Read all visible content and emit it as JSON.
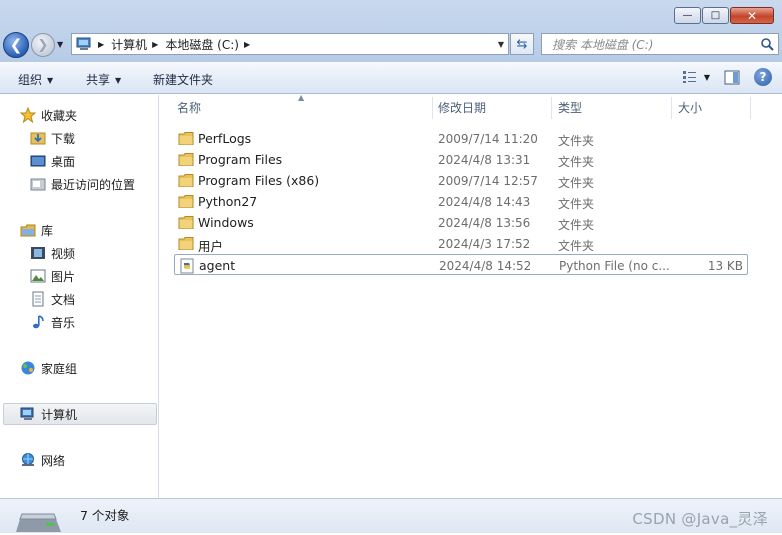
{
  "window": {
    "minimize_glyph": "—",
    "maximize_glyph": "□",
    "close_glyph": "✕"
  },
  "address_bar": {
    "breadcrumbs": [
      "计算机",
      "本地磁盘 (C:)"
    ]
  },
  "search": {
    "placeholder": "搜索 本地磁盘 (C:)"
  },
  "command_bar": {
    "organize": "组织",
    "share": "共享",
    "new_folder": "新建文件夹"
  },
  "nav_pane": {
    "favorites": "收藏夹",
    "downloads": "下载",
    "desktop": "桌面",
    "recent": "最近访问的位置",
    "libraries": "库",
    "videos": "视频",
    "pictures": "图片",
    "documents": "文档",
    "music": "音乐",
    "homegroup": "家庭组",
    "computer": "计算机",
    "network": "网络"
  },
  "columns": {
    "name": "名称",
    "date": "修改日期",
    "type": "类型",
    "size": "大小"
  },
  "files": [
    {
      "name": "PerfLogs",
      "date": "2009/7/14 11:20",
      "type": "文件夹",
      "size": "",
      "icon": "folder-icon"
    },
    {
      "name": "Program Files",
      "date": "2024/4/8 13:31",
      "type": "文件夹",
      "size": "",
      "icon": "folder-icon"
    },
    {
      "name": "Program Files (x86)",
      "date": "2009/7/14 12:57",
      "type": "文件夹",
      "size": "",
      "icon": "folder-icon"
    },
    {
      "name": "Python27",
      "date": "2024/4/8 14:43",
      "type": "文件夹",
      "size": "",
      "icon": "folder-icon"
    },
    {
      "name": "Windows",
      "date": "2024/4/8 13:56",
      "type": "文件夹",
      "size": "",
      "icon": "folder-icon"
    },
    {
      "name": "用户",
      "date": "2024/4/3 17:52",
      "type": "文件夹",
      "size": "",
      "icon": "folder-icon"
    },
    {
      "name": "agent",
      "date": "2024/4/8 14:52",
      "type": "Python File (no c...",
      "size": "13 KB",
      "icon": "python-file-icon"
    }
  ],
  "status": {
    "count": "7 个对象",
    "watermark": "CSDN @Java_灵泽"
  },
  "colors": {
    "titlebar": "#c5d6ec",
    "folder": "#e8c35a",
    "selection_border": "#99aac4"
  }
}
